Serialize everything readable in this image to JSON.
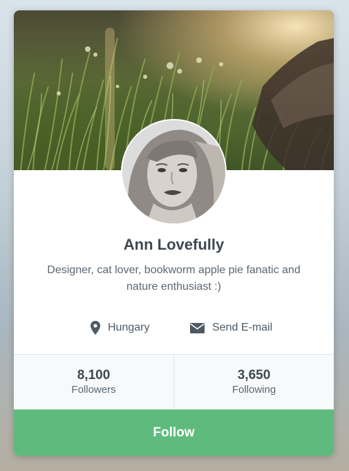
{
  "profile": {
    "name": "Ann Lovefully",
    "bio": "Designer, cat lover, bookworm apple pie fanatic and nature enthusiast :)",
    "location": "Hungary",
    "email_label": "Send E-mail"
  },
  "stats": [
    {
      "value": "8,100",
      "label": "Followers"
    },
    {
      "value": "3,650",
      "label": "Following"
    }
  ],
  "actions": {
    "follow_label": "Follow"
  },
  "icons": {
    "location": "map-pin-icon",
    "email": "envelope-icon"
  },
  "colors": {
    "accent": "#5fbb7d",
    "text_dark": "#3e4852",
    "text_muted": "#5b6670"
  }
}
